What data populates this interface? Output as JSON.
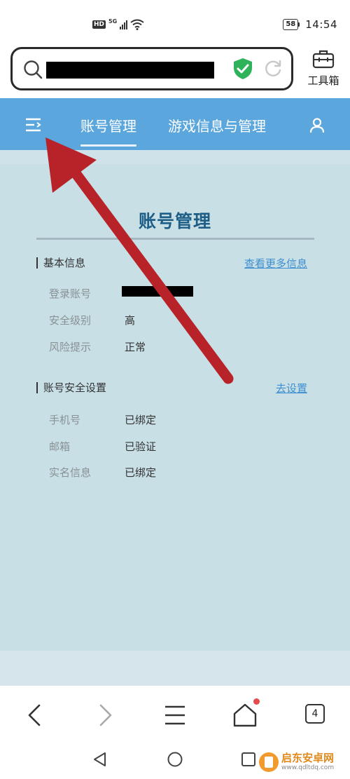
{
  "status_bar": {
    "hd": "HD",
    "network": "5G",
    "battery": "58",
    "time": "14:54"
  },
  "browser": {
    "toolbox_label": "工具箱",
    "tab_count": "4"
  },
  "site_nav": {
    "tabs": [
      {
        "label": "账号管理",
        "active": true
      },
      {
        "label": "游戏信息与管理",
        "active": false
      }
    ]
  },
  "page": {
    "title": "账号管理",
    "basic": {
      "title": "基本信息",
      "link": "查看更多信息",
      "rows": [
        {
          "label": "登录账号",
          "value": ""
        },
        {
          "label": "安全级别",
          "value": "高"
        },
        {
          "label": "风险提示",
          "value": "正常"
        }
      ]
    },
    "security": {
      "title": "账号安全设置",
      "link": "去设置",
      "rows": [
        {
          "label": "手机号",
          "value": "已绑定"
        },
        {
          "label": "邮箱",
          "value": "已验证"
        },
        {
          "label": "实名信息",
          "value": "已绑定"
        }
      ]
    }
  },
  "watermark": {
    "name": "启东安卓网",
    "url": "www.qdltdq.com"
  },
  "colors": {
    "nav_blue": "#5aa6dd",
    "content_bg": "#c7dfe5",
    "title_blue": "#1d5d86",
    "link_blue": "#3f8fd0",
    "arrow_red": "#b8232a",
    "shield_green": "#2fb35a"
  },
  "icons": [
    "search-icon",
    "shield-check-icon",
    "reload-icon",
    "toolbox-icon",
    "menu-icon",
    "user-icon",
    "back-icon",
    "forward-icon",
    "menu-lines-icon",
    "home-icon",
    "tabs-icon",
    "android-back-icon",
    "android-home-icon",
    "android-recents-icon"
  ]
}
